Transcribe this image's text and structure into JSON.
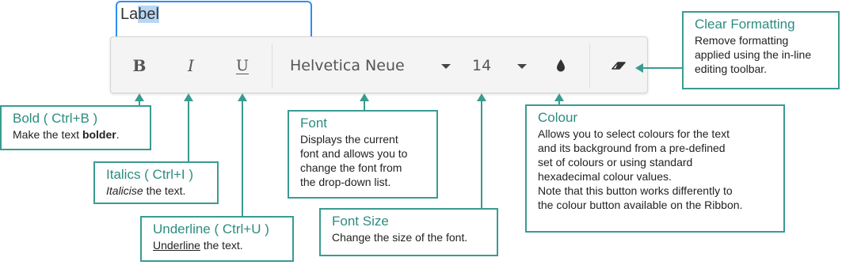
{
  "field": {
    "text_pre": "La",
    "text_selected": "bel"
  },
  "toolbar": {
    "bold_label": "B",
    "italic_label": "I",
    "underline_label": "U",
    "font_value": "Helvetica Neue",
    "size_value": "14",
    "colour_icon": "drop-icon",
    "clear_icon": "eraser-icon"
  },
  "callouts": {
    "bold": {
      "title": "Bold ( Ctrl+B )",
      "desc_pre": "Make the text ",
      "desc_em": "bolder",
      "desc_post": "."
    },
    "italics": {
      "title": "Italics ( Ctrl+I )",
      "desc_em": "Italicise",
      "desc_post": " the text."
    },
    "underline": {
      "title": "Underline ( Ctrl+U )",
      "desc_em": "Underline",
      "desc_post": " the text."
    },
    "font": {
      "title": "Font",
      "lines": [
        "Displays the current",
        "font and allows you to",
        "change the font from",
        "the drop-down list."
      ]
    },
    "font_size": {
      "title": "Font Size",
      "desc": "Change the size of the font."
    },
    "colour": {
      "title": "Colour",
      "lines": [
        "Allows you to select colours for the text",
        "and its background from a pre-defined",
        "set of colours or using standard",
        "hexadecimal colour values.",
        "Note that this button works differently to",
        "the colour button available on the Ribbon."
      ]
    },
    "clear": {
      "title": "Clear Formatting",
      "lines": [
        "Remove formatting",
        "applied using the in-line",
        "editing toolbar."
      ]
    }
  },
  "colors": {
    "accent": "#3a9b90",
    "title": "#2d8c80",
    "focus": "#2f8df0",
    "selection": "#b8d7f5"
  }
}
